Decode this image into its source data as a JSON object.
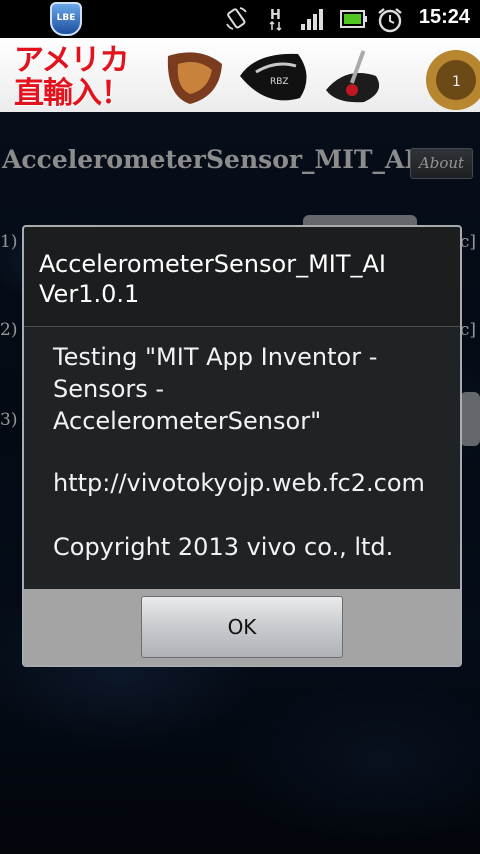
{
  "status_bar": {
    "app_badge": "LBE",
    "icons": [
      "rotate-icon",
      "signal-h-icon",
      "signal-bars-icon",
      "battery-icon",
      "alarm-icon"
    ],
    "time": "15:24"
  },
  "ad_banner": {
    "text_line1": "アメリカ",
    "text_line2": "直輸入！"
  },
  "app": {
    "title": "AccelerometerSensor_MIT_AI",
    "about_label": "About",
    "rows": [
      {
        "label": "1)",
        "suffix": "c]"
      },
      {
        "label": "2)",
        "suffix": "c]"
      },
      {
        "label": "3)"
      }
    ]
  },
  "dialog": {
    "title_line1": "AccelerometerSensor_MIT_AI",
    "title_line2": "Ver1.0.1",
    "message_line1": "Testing \"MIT App Inventor -",
    "message_line2": "Sensors -",
    "message_line3": "AccelerometerSensor\"",
    "url": "http://vivotokyojp.web.fc2.com",
    "copyright": "Copyright 2013 vivo co., ltd.",
    "ok_label": "OK"
  }
}
